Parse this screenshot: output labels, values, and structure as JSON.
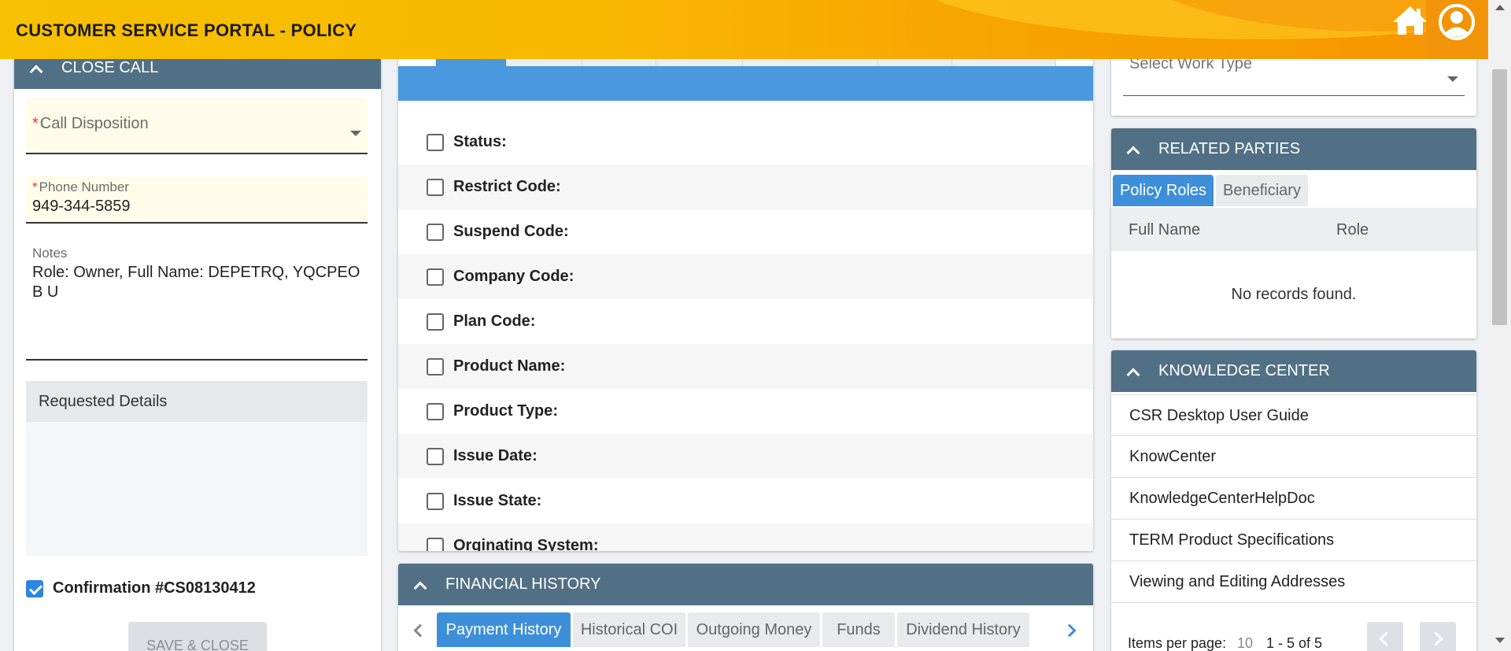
{
  "header": {
    "title": "CUSTOMER SERVICE PORTAL - POLICY"
  },
  "close_call": {
    "title": "CLOSE CALL",
    "call_disposition_label": "Call Disposition",
    "phone_label": "Phone Number",
    "phone_value": "949-344-5859",
    "notes_label": "Notes",
    "notes_value": "Role: Owner, Full Name: DEPETRQ, YQCPEOB U",
    "requested_details_label": "Requested Details",
    "confirmation_label": "Confirmation #CS08130412",
    "confirmation_checked": true,
    "save_button": "SAVE & CLOSE"
  },
  "policy_fields": [
    {
      "label": "Status",
      "sep": ":"
    },
    {
      "label": "Restrict Code",
      "sep": ":"
    },
    {
      "label": "Suspend Code",
      "sep": ":"
    },
    {
      "label": "Company Code",
      "sep": ":"
    },
    {
      "label": "Plan Code",
      "sep": ":"
    },
    {
      "label": "Product Name",
      "sep": ":"
    },
    {
      "label": "Product Type",
      "sep": ":"
    },
    {
      "label": "Issue Date",
      "sep": ":"
    },
    {
      "label": "Issue State",
      "sep": ":"
    },
    {
      "label": "Orginating System",
      "sep": ":"
    }
  ],
  "financial_history": {
    "title": "FINANCIAL HISTORY",
    "tabs": [
      "Payment History",
      "Historical COI",
      "Outgoing Money",
      "Funds",
      "Dividend History"
    ],
    "active_tab": "Payment History"
  },
  "work_type": {
    "placeholder": "Select Work Type"
  },
  "related_parties": {
    "title": "RELATED PARTIES",
    "tabs": [
      "Policy Roles",
      "Beneficiary"
    ],
    "active_tab": "Policy Roles",
    "columns": [
      "Full Name",
      "Role"
    ],
    "empty_message": "No records found."
  },
  "knowledge_center": {
    "title": "KNOWLEDGE CENTER",
    "items": [
      "CSR Desktop User Guide",
      "KnowCenter",
      "KnowledgeCenterHelpDoc",
      "TERM Product Specifications",
      "Viewing and Editing Addresses"
    ],
    "items_per_page_label": "Items per page:",
    "items_per_page": "10",
    "range": "1 - 5 of 5"
  },
  "colors": {
    "header_gradient_start": "#f7c000",
    "header_gradient_end": "#f59500",
    "panel_header": "#517085",
    "accent_blue": "#4a99de",
    "field_highlight": "#fffde9"
  }
}
